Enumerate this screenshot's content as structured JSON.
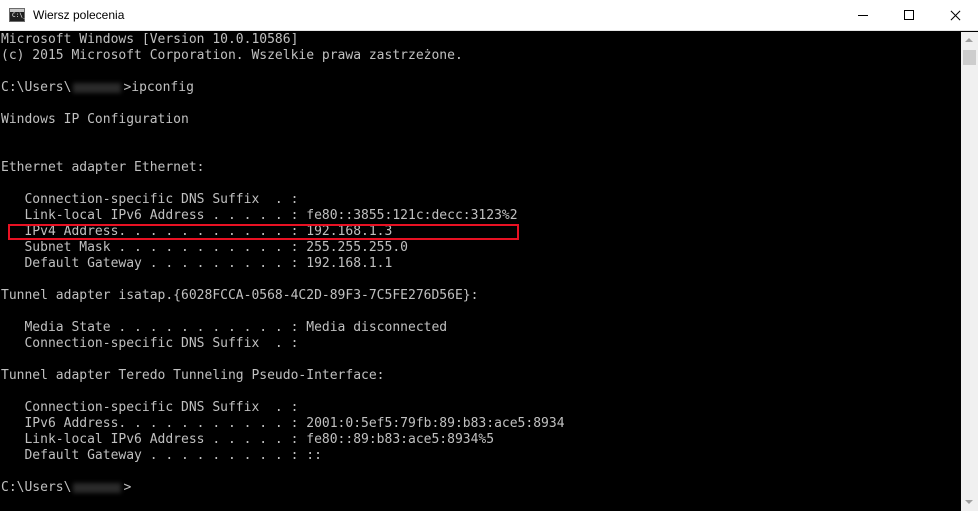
{
  "window": {
    "title": "Wiersz polecenia",
    "icon": "cmd-icon",
    "icon_text": "C:\\_"
  },
  "controls": {
    "minimize": "minimize-icon",
    "maximize": "maximize-icon",
    "close": "close-icon"
  },
  "console": {
    "lines": [
      "Microsoft Windows [Version 10.0.10586]",
      "(c) 2015 Microsoft Corporation. Wszelkie prawa zastrzeżone.",
      "",
      "",
      "",
      "Windows IP Configuration",
      "",
      "",
      "Ethernet adapter Ethernet:",
      "",
      "   Connection-specific DNS Suffix  . :",
      "   Link-local IPv6 Address . . . . . : fe80::3855:121c:decc:3123%2",
      "   IPv4 Address. . . . . . . . . . . : 192.168.1.3",
      "   Subnet Mask . . . . . . . . . . . : 255.255.255.0",
      "   Default Gateway . . . . . . . . . : 192.168.1.1",
      "",
      "Tunnel adapter isatap.{6028FCCA-0568-4C2D-89F3-7C5FE276D56E}:",
      "",
      "   Media State . . . . . . . . . . . : Media disconnected",
      "   Connection-specific DNS Suffix  . :",
      "",
      "Tunnel adapter Teredo Tunneling Pseudo-Interface:",
      "",
      "   Connection-specific DNS Suffix  . :",
      "   IPv6 Address. . . . . . . . . . . : 2001:0:5ef5:79fb:89:b83:ace5:8934",
      "   Link-local IPv6 Address . . . . . : fe80::89:b83:ace5:8934%5",
      "   Default Gateway . . . . . . . . . : ::",
      "",
      ""
    ],
    "prompt_prefix": "C:\\Users\\",
    "command": "ipconfig",
    "highlight_color": "#e81123",
    "text_color": "#c0c0c0",
    "background_color": "#000000"
  }
}
